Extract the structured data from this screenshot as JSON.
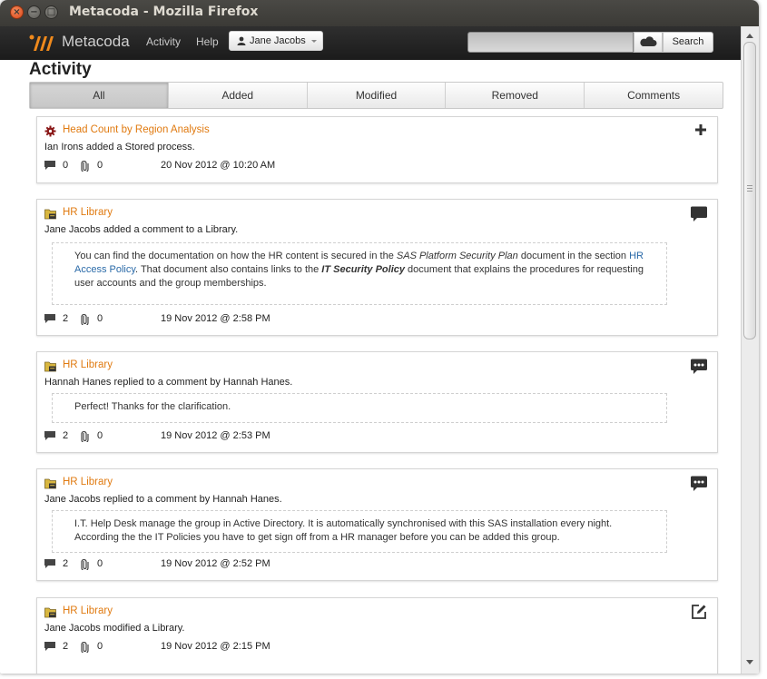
{
  "window": {
    "title": "Metacoda - Mozilla Firefox"
  },
  "navbar": {
    "brand": "Metacoda",
    "links": [
      "Activity",
      "Help"
    ],
    "user": "Jane Jacobs",
    "search_placeholder": "",
    "search_label": "Search"
  },
  "page": {
    "title": "Activity"
  },
  "tabs": [
    {
      "label": "All",
      "active": true
    },
    {
      "label": "Added",
      "active": false
    },
    {
      "label": "Modified",
      "active": false
    },
    {
      "label": "Removed",
      "active": false
    },
    {
      "label": "Comments",
      "active": false
    }
  ],
  "colors": {
    "accent": "#e07a10",
    "link": "#2a6aa8"
  },
  "activities": [
    {
      "icon": "stored-process-icon",
      "title": "Head Count by Region Analysis",
      "description": "Ian Irons added a Stored process.",
      "action_icon": "plus-icon",
      "comments": "0",
      "attachments": "0",
      "timestamp": "20 Nov 2012 @ 10:20 AM"
    },
    {
      "icon": "library-icon",
      "title": "HR Library",
      "description": "Jane Jacobs added a comment to a Library.",
      "action_icon": "comment-icon",
      "quote": {
        "t1": "You can find the documentation on how the HR content is secured in the ",
        "em1": "SAS Platform Security Plan",
        "t2": " document in the section ",
        "link": "HR Access Policy",
        "t3": ". That document also contains links to the ",
        "strong": "IT Security Policy",
        "t4": " document that explains the procedures for requesting user accounts and the group memberships."
      },
      "comments": "2",
      "attachments": "0",
      "timestamp": "19 Nov 2012 @ 2:58 PM"
    },
    {
      "icon": "library-icon",
      "title": "HR Library",
      "description": "Hannah Hanes replied to a comment by Hannah Hanes.",
      "action_icon": "reply-comment-icon",
      "quote": {
        "text": "Perfect! Thanks for the clarification."
      },
      "comments": "2",
      "attachments": "0",
      "timestamp": "19 Nov 2012 @ 2:53 PM"
    },
    {
      "icon": "library-icon",
      "title": "HR Library",
      "description": "Jane Jacobs replied to a comment by Hannah Hanes.",
      "action_icon": "reply-comment-icon",
      "quote": {
        "text": "I.T. Help Desk manage the group in Active Directory. It is automatically synchronised with this SAS installation every night. According the the IT Policies you have to get sign off from a HR manager before you can be added this group."
      },
      "comments": "2",
      "attachments": "0",
      "timestamp": "19 Nov 2012 @ 2:52 PM"
    },
    {
      "icon": "library-icon",
      "title": "HR Library",
      "description": "Jane Jacobs modified a Library.",
      "action_icon": "edit-icon",
      "comments": "2",
      "attachments": "0",
      "timestamp": "19 Nov 2012 @ 2:15 PM"
    }
  ]
}
